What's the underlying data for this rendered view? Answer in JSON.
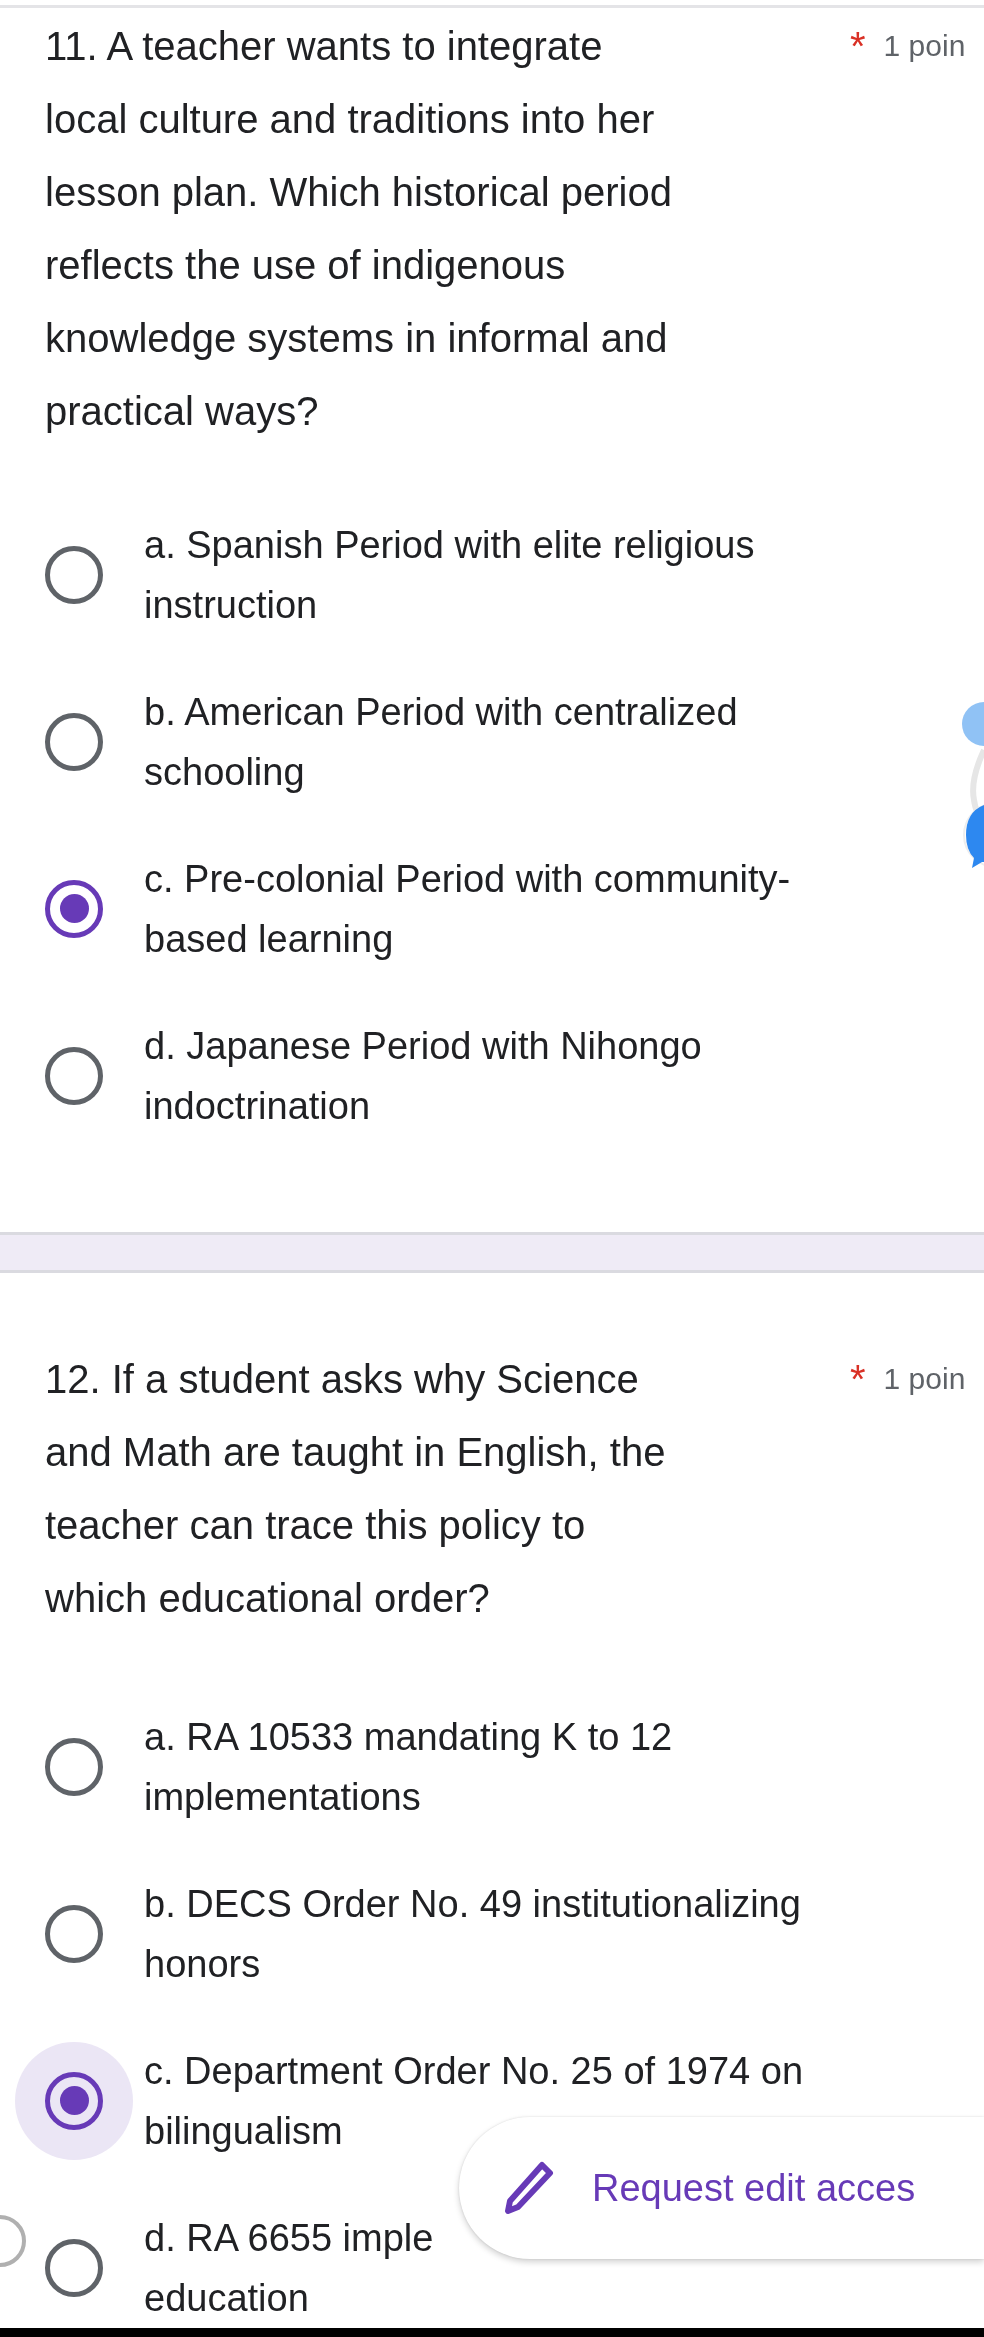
{
  "questions": [
    {
      "title_lines": [
        "11. A teacher wants to integrate",
        "local culture and traditions into her",
        "lesson plan. Which historical period",
        "reflects the use of indigenous",
        "knowledge systems in informal and",
        "practical ways?"
      ],
      "required_mark": "*",
      "points": "1 poin",
      "options": [
        {
          "lines": [
            "a. Spanish Period with elite religious",
            "instruction"
          ],
          "selected": false,
          "focused": false
        },
        {
          "lines": [
            "b. American Period with centralized",
            "schooling"
          ],
          "selected": false,
          "focused": false
        },
        {
          "lines": [
            "c. Pre-colonial Period with community-",
            "based learning"
          ],
          "selected": true,
          "focused": false
        },
        {
          "lines": [
            "d. Japanese Period with Nihongo",
            "indoctrination"
          ],
          "selected": false,
          "focused": false
        }
      ]
    },
    {
      "title_lines": [
        "12. If a student asks why Science",
        "and Math are taught in English, the",
        "teacher can trace this policy to",
        "which educational order?"
      ],
      "required_mark": "*",
      "points": "1 poin",
      "options": [
        {
          "lines": [
            "a. RA 10533 mandating K to 12",
            "implementations"
          ],
          "selected": false,
          "focused": false
        },
        {
          "lines": [
            "b. DECS Order No. 49 institutionalizing",
            "honors"
          ],
          "selected": false,
          "focused": false
        },
        {
          "lines": [
            "c. Department Order No. 25 of 1974 on",
            "bilingualism"
          ],
          "selected": true,
          "focused": true
        },
        {
          "lines": [
            "d. RA 6655 imple",
            "education"
          ],
          "selected": false,
          "focused": false
        }
      ]
    }
  ],
  "request_button": {
    "label": "Request edit acces"
  }
}
